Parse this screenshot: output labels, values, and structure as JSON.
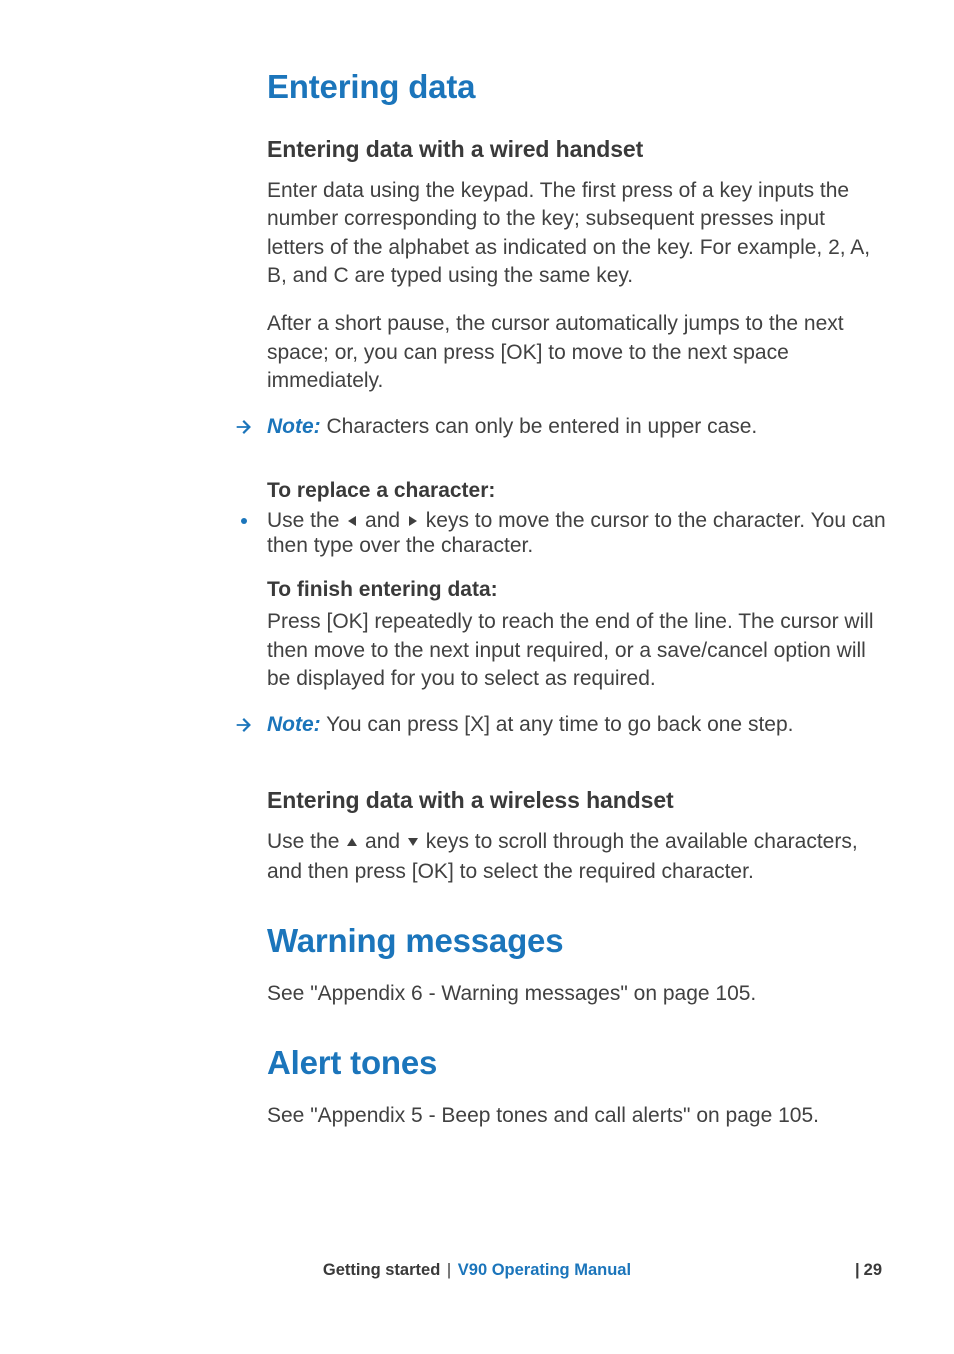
{
  "headings": {
    "h1_entering": "Entering data",
    "h2_wired": "Entering data with a wired handset",
    "h3_replace": "To replace a character:",
    "h3_finish": "To finish entering data:",
    "h2_wireless": "Entering data with a wireless handset",
    "h1_warning": "Warning messages",
    "h1_alert": "Alert tones"
  },
  "body": {
    "p_enter1": "Enter data using the keypad. The first press of a key inputs the number corresponding to the key; subsequent presses input letters of the alphabet as indicated on the key. For example, 2, A, B, and C are typed using the same key.",
    "p_enter2": "After a short pause, the cursor automatically jumps to the next space; or, you can press [OK] to move to the next space immediately.",
    "note1_label": "Note:",
    "note1_text": " Characters can only be entered in upper case.",
    "bullet_pre": "Use the ",
    "bullet_mid": " and ",
    "bullet_post": " keys to move the cursor to the character. You can then type over the character.",
    "p_finish": "Press [OK] repeatedly to reach the end of the line. The cursor will then move to the next input required, or a save/cancel option will be displayed for you to select as required.",
    "note2_label": "Note:",
    "note2_text": " You can press [X] at any time to go back one step.",
    "wireless_pre": "Use the ",
    "wireless_mid": " and ",
    "wireless_post": " keys to scroll through the available characters, and then press [OK] to select the required character.",
    "p_warning": "See \"Appendix 6 -  Warning messages\" on page 105.",
    "p_alert": "See \"Appendix 5 -  Beep tones and call alerts\" on page 105."
  },
  "footer": {
    "section": "Getting started",
    "doc": "V90 Operating Manual",
    "page_bar": "|",
    "page_num": "29"
  }
}
